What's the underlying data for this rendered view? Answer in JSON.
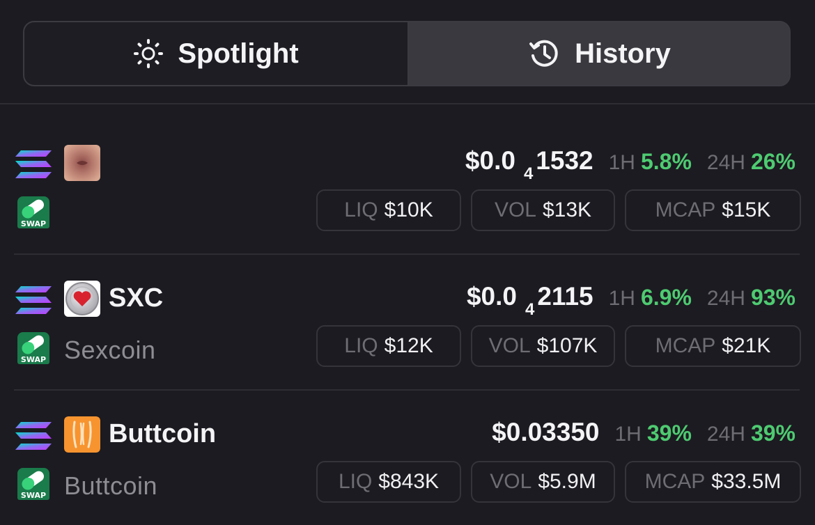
{
  "tabs": {
    "spotlight": {
      "label": "Spotlight",
      "icon": "sun-icon"
    },
    "history": {
      "label": "History",
      "icon": "history-icon"
    }
  },
  "colors": {
    "positive": "#4ecb71",
    "background": "#1c1b21",
    "muted": "#6e6d74"
  },
  "tokens": [
    {
      "symbol": "",
      "name": "",
      "chain_icon": "solana-icon",
      "dex_icon": "swap-pill-icon",
      "logo": "token-logo",
      "price_prefix": "$0.0",
      "price_zeros": "4",
      "price_digits": "1532",
      "h1_label": "1H",
      "h1_value": "5.8%",
      "h24_label": "24H",
      "h24_value": "26%",
      "liq_label": "LIQ",
      "liq_value": "$10K",
      "vol_label": "VOL",
      "vol_value": "$13K",
      "mcap_label": "MCAP",
      "mcap_value": "$15K"
    },
    {
      "symbol": "SXC",
      "name": "Sexcoin",
      "chain_icon": "solana-icon",
      "dex_icon": "swap-pill-icon",
      "logo": "heart-coin-logo",
      "price_prefix": "$0.0",
      "price_zeros": "4",
      "price_digits": "2115",
      "h1_label": "1H",
      "h1_value": "6.9%",
      "h24_label": "24H",
      "h24_value": "93%",
      "liq_label": "LIQ",
      "liq_value": "$12K",
      "vol_label": "VOL",
      "vol_value": "$107K",
      "mcap_label": "MCAP",
      "mcap_value": "$21K"
    },
    {
      "symbol": "Buttcoin",
      "name": "Buttcoin",
      "chain_icon": "solana-icon",
      "dex_icon": "swap-pill-icon",
      "logo": "buttcoin-logo",
      "price_full": "$0.03350",
      "h1_label": "1H",
      "h1_value": "39%",
      "h24_label": "24H",
      "h24_value": "39%",
      "liq_label": "LIQ",
      "liq_value": "$843K",
      "vol_label": "VOL",
      "vol_value": "$5.9M",
      "mcap_label": "MCAP",
      "mcap_value": "$33.5M"
    }
  ]
}
